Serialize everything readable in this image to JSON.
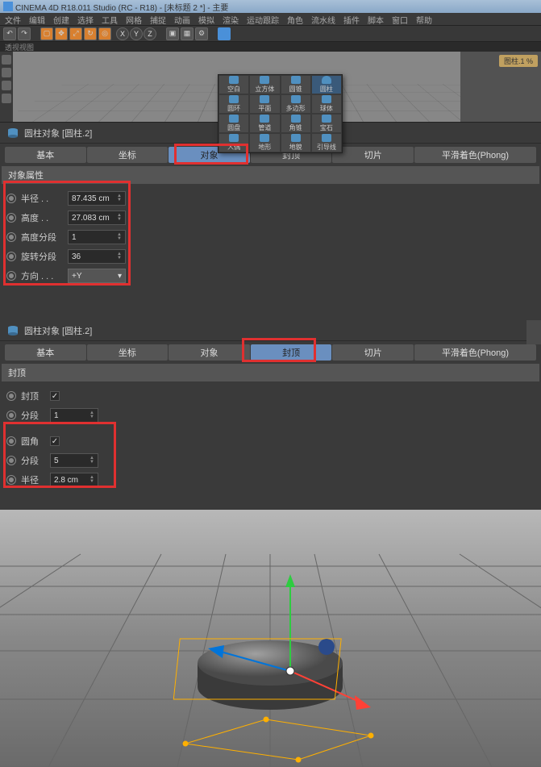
{
  "titlebar": {
    "text": "CINEMA 4D R18.011 Studio (RC - R18) - [未标题 2 *] - 主要"
  },
  "menubar": [
    "文件",
    "编辑",
    "创建",
    "选择",
    "工具",
    "网格",
    "捕捉",
    "动画",
    "模拟",
    "渲染",
    "运动跟踪",
    "角色",
    "流水线",
    "插件",
    "脚本",
    "窗口",
    "帮助"
  ],
  "viewport_header": "透视视图",
  "right_tab": "图柱.1 %",
  "primitives": {
    "rows": [
      [
        "空白",
        "立方体",
        "圆锥",
        "圆柱"
      ],
      [
        "圆环",
        "平面",
        "多边形",
        "球体"
      ],
      [
        "圆盘",
        "管道",
        "角锥",
        "宝石"
      ],
      [
        "人偶",
        "地形",
        "地貌",
        "引导线"
      ]
    ],
    "selected": "圆柱"
  },
  "panel1": {
    "title": "圆柱对象 [圆柱.2]",
    "tabs": [
      "基本",
      "坐标",
      "对象",
      "封顶",
      "切片",
      "平滑着色(Phong)"
    ],
    "active_tab": "对象",
    "section": "对象属性",
    "props": [
      {
        "label": "半径 . .",
        "value": "87.435 cm",
        "type": "num"
      },
      {
        "label": "高度 . .",
        "value": "27.083 cm",
        "type": "num"
      },
      {
        "label": "高度分段",
        "value": "1",
        "type": "num"
      },
      {
        "label": "旋转分段",
        "value": "36",
        "type": "num"
      },
      {
        "label": "方向 . . .",
        "value": "+Y",
        "type": "select"
      }
    ]
  },
  "panel2": {
    "title": "圆柱对象 [圆柱.2]",
    "tabs": [
      "基本",
      "坐标",
      "对象",
      "封顶",
      "切片",
      "平滑着色(Phong)"
    ],
    "active_tab": "封顶",
    "section": "封顶",
    "props_top": [
      {
        "label": "封顶",
        "checked": true,
        "type": "check"
      },
      {
        "label": "分段",
        "value": "1",
        "type": "num"
      }
    ],
    "props_fillet": [
      {
        "label": "圆角",
        "checked": true,
        "type": "check"
      },
      {
        "label": "分段",
        "value": "5",
        "type": "num"
      },
      {
        "label": "半径",
        "value": "2.8 cm",
        "type": "num"
      }
    ]
  }
}
